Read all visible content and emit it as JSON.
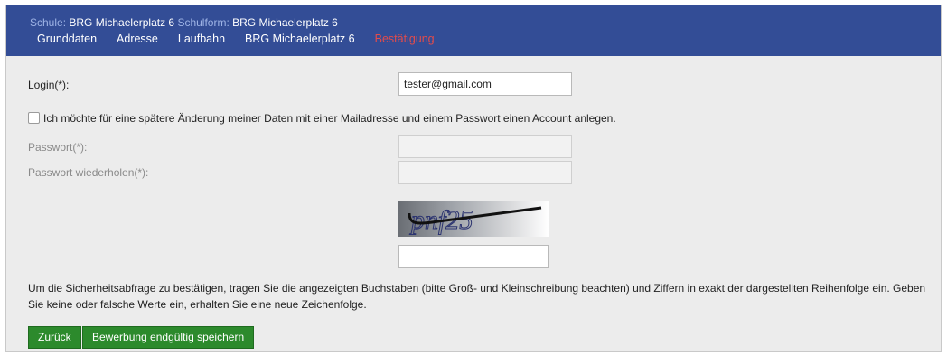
{
  "header": {
    "school_label": "Schule:",
    "school_value": "BRG Michaelerplatz 6",
    "schoolform_label": "Schulform:",
    "schoolform_value": "BRG Michaelerplatz 6",
    "tabs": [
      {
        "label": "Grunddaten"
      },
      {
        "label": "Adresse"
      },
      {
        "label": "Laufbahn"
      },
      {
        "label": "BRG Michaelerplatz 6"
      },
      {
        "label": "Bestätigung"
      }
    ],
    "active_tab_color": "#e24b4b",
    "bg_color": "#334d96"
  },
  "form": {
    "login_label": "Login(*):",
    "login_value": "tester@gmail.com",
    "account_checkbox_label": "Ich möchte für eine spätere Änderung meiner Daten mit einer Mailadresse und einem Passwort einen Account anlegen.",
    "account_checked": false,
    "password_label": "Passwort(*):",
    "password_repeat_label": "Passwort wiederholen(*):",
    "captcha_text": "pnf25",
    "help_text": "Um die Sicherheitsabfrage zu bestätigen, tragen Sie die angezeigten Buchstaben (bitte Groß- und Kleinschreibung beachten) und Ziffern in exakt der dargestellten Reihenfolge ein. Geben Sie keine oder falsche Werte ein, erhalten Sie eine neue Zeichenfolge."
  },
  "buttons": {
    "back_label": "Zurück",
    "save_label": "Bewerbung endgültig speichern",
    "color": "#2c8a2c"
  }
}
